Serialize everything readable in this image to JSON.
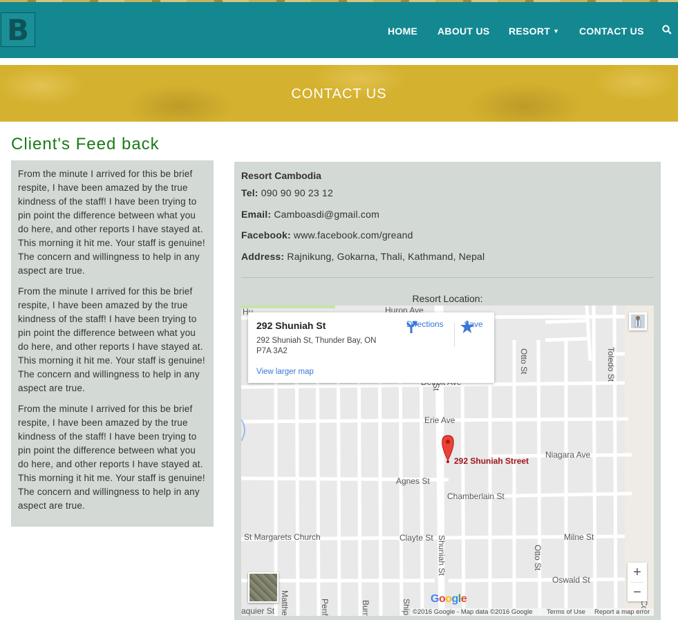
{
  "header": {
    "logo_letter": "B",
    "nav": [
      {
        "label": "HOME"
      },
      {
        "label": "ABOUT US"
      },
      {
        "label": "RESORT"
      },
      {
        "label": "CONTACT US"
      }
    ],
    "accent": "#138891"
  },
  "banner": {
    "title": "CONTACT US",
    "color": "#d4b12e"
  },
  "feedback": {
    "heading": "Client's Feed back",
    "paragraphs": [
      "From the minute I arrived for this be brief respite, I have been amazed by the true kindness of the staff! I have been trying to pin point the difference between what you do here, and other reports I have stayed at. This morning it hit me. Your staff is genuine! The concern and willingness to help in any aspect are true.",
      "From the minute I arrived for this be brief respite, I have been amazed by the true kindness of the staff! I have been trying to pin point the difference between what you do here, and other reports I have stayed at. This morning it hit me. Your staff is genuine! The concern and willingness to help in any aspect are true.",
      "From the minute I arrived for this be brief respite, I have been amazed by the true kindness of the staff! I have been trying to pin point the difference between what you do here, and other reports I have stayed at. This morning it hit me. Your staff is genuine! The concern and willingness to help in any aspect are true."
    ]
  },
  "contact": {
    "name": "Resort Cambodia",
    "tel_label": "Tel:",
    "tel": "090 90 90 23 12",
    "email_label": "Email:",
    "email": "Camboasdi@gmail.com",
    "facebook_label": "Facebook:",
    "facebook": "www.facebook.com/greand",
    "address_label": "Address:",
    "address": "Rajnikung, Gokarna, Thali, Kathmand, Nepal",
    "location_label": "Resort Location:"
  },
  "map": {
    "place_title": "292 Shuniah St",
    "place_address": "292 Shuniah St, Thunder Bay, ON P7A 3A2",
    "directions": "Directions",
    "save": "Save",
    "larger_map": "View larger map",
    "pin_label": "292 Shuniah Street",
    "streets": {
      "huron": "Huron Ave",
      "detroit": "Detroit Ave",
      "erie": "Erie Ave",
      "niagara": "Niagara Ave",
      "agnes": "Agnes St",
      "chamberlain": "Chamberlain St",
      "st_margarets": "St Margarets Church",
      "clayte": "Clayte St",
      "milne": "Milne St",
      "oswald": "Oswald St",
      "otto1": "Otto St",
      "otto2": "Otto St",
      "toledo": "Toledo St",
      "shuniah": "Shuniah St",
      "shuniah_top": "St",
      "daquier": "aquier St",
      "matthe": "Matthe",
      "penf": "Penf",
      "burn": "Burn",
      "ship": "Ship",
      "co": "Co",
      "hu": "Hu"
    },
    "zoom_in": "+",
    "zoom_out": "−",
    "google": [
      "G",
      "o",
      "o",
      "g",
      "l",
      "e"
    ],
    "copyright": "©2016 Google - Map data ©2016 Google",
    "terms": "Terms of Use",
    "report": "Report a map error"
  }
}
